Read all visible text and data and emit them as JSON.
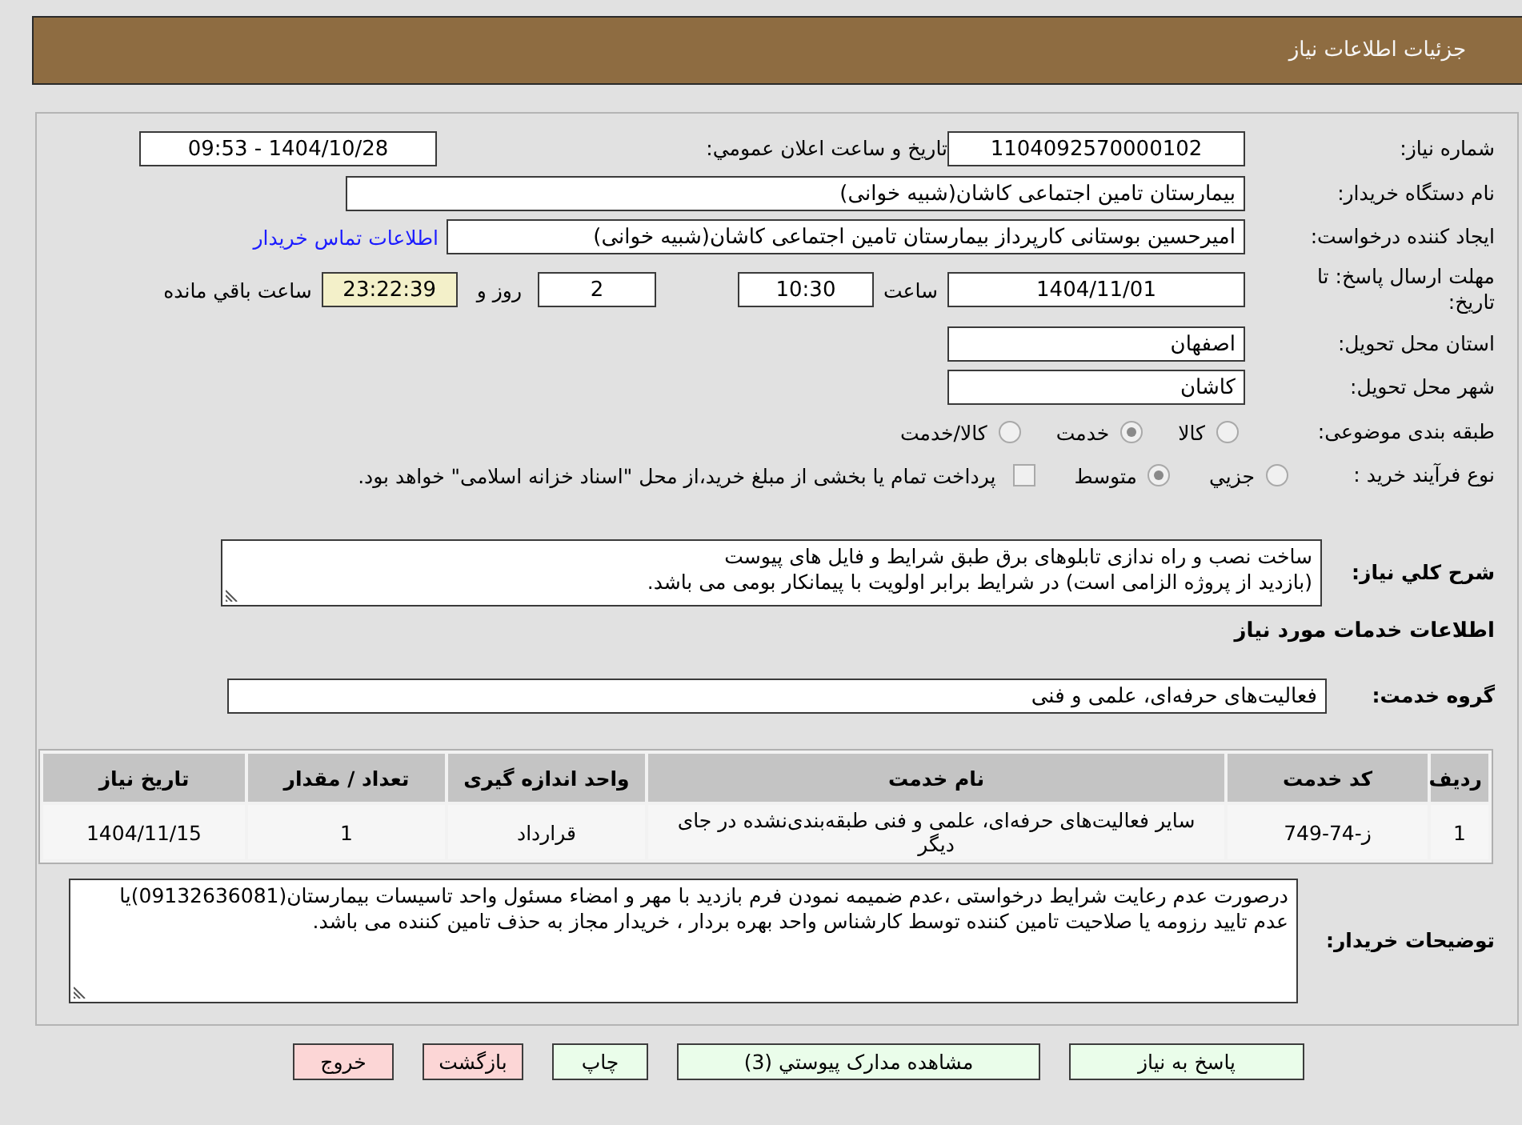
{
  "header": {
    "title": "جزئیات اطلاعات نیاز"
  },
  "need_number": {
    "label": "شماره نیاز:",
    "value": "1104092570000102"
  },
  "announcement": {
    "label": "تاریخ و ساعت اعلان عمومي:",
    "value": "1404/10/28 - 09:53"
  },
  "buyer_org": {
    "label": "نام دستگاه خریدار:",
    "value": "بیمارستان تامین اجتماعی کاشان(شبیه خوانی)"
  },
  "requester": {
    "label": "ایجاد کننده درخواست:",
    "value": "امیرحسین بوستانی کارپرداز بیمارستان تامین اجتماعی کاشان(شبیه خوانی)",
    "contact_link": "اطلاعات تماس خریدار"
  },
  "deadline": {
    "label": "مهلت ارسال پاسخ: تا تاریخ:",
    "date": "1404/11/01",
    "time_label": "ساعت",
    "time": "10:30",
    "days": "2",
    "days_label": "روز و",
    "remaining": "23:22:39",
    "remaining_label": "ساعت باقي مانده"
  },
  "province": {
    "label": "استان محل تحویل:",
    "value": "اصفهان"
  },
  "city": {
    "label": "شهر محل تحویل:",
    "value": "کاشان"
  },
  "category": {
    "label": "طبقه بندی موضوعی:",
    "options": [
      {
        "label": "کالا",
        "selected": false
      },
      {
        "label": "خدمت",
        "selected": true
      },
      {
        "label": "کالا/خدمت",
        "selected": false
      }
    ]
  },
  "purchase_process": {
    "label": "نوع فرآیند خرید :",
    "options": [
      {
        "label": "جزيي",
        "selected": false
      },
      {
        "label": "متوسط",
        "selected": true
      }
    ],
    "treasury_option": {
      "label": "پرداخت تمام یا بخشی از مبلغ خرید،از محل \"اسناد خزانه اسلامی\" خواهد بود.",
      "checked": false
    }
  },
  "description": {
    "label": "شرح كلي نياز:",
    "value": "ساخت نصب و راه ندازی تابلوهای برق طبق شرایط و فایل های پیوست\n(بازدید از پروژه الزامی است) در شرایط برابر اولویت با پیمانکار بومی می باشد."
  },
  "services": {
    "heading": "اطلاعات خدمات مورد نیاز",
    "group_label": "گروه خدمت:",
    "group_value": "فعالیت‌های حرفه‌ای، علمی و فنی",
    "table": {
      "columns": [
        "ردیف",
        "کد خدمت",
        "نام خدمت",
        "واحد اندازه گیری",
        "تعداد / مقدار",
        "تاریخ نیاز"
      ],
      "rows": [
        [
          "1",
          "ز-74-749",
          "سایر فعالیت‌های حرفه‌ای، علمی و فنی طبقه‌بندی‌نشده در جای دیگر",
          "قرارداد",
          "1",
          "1404/11/15"
        ]
      ]
    }
  },
  "buyer_notes": {
    "label": "توضیحات خریدار:",
    "value": "درصورت عدم رعایت شرایط درخواستی ،عدم ضمیمه نمودن فرم بازدید با مهر و امضاء مسئول واحد تاسیسات بیمارستان(09132636081)یا عدم تایید رزومه یا صلاحیت تامین کننده توسط کارشناس واحد بهره بردار ، خریدار مجاز به حذف تامین کننده می باشد."
  },
  "buttons": [
    {
      "label": "پاسخ به نیاز",
      "kind": "action"
    },
    {
      "label": "مشاهده مدارک پیوستي (3)",
      "kind": "action"
    },
    {
      "label": "چاپ",
      "kind": "action"
    },
    {
      "label": "بازگشت",
      "kind": "exit"
    },
    {
      "label": "خروج",
      "kind": "exit"
    }
  ]
}
